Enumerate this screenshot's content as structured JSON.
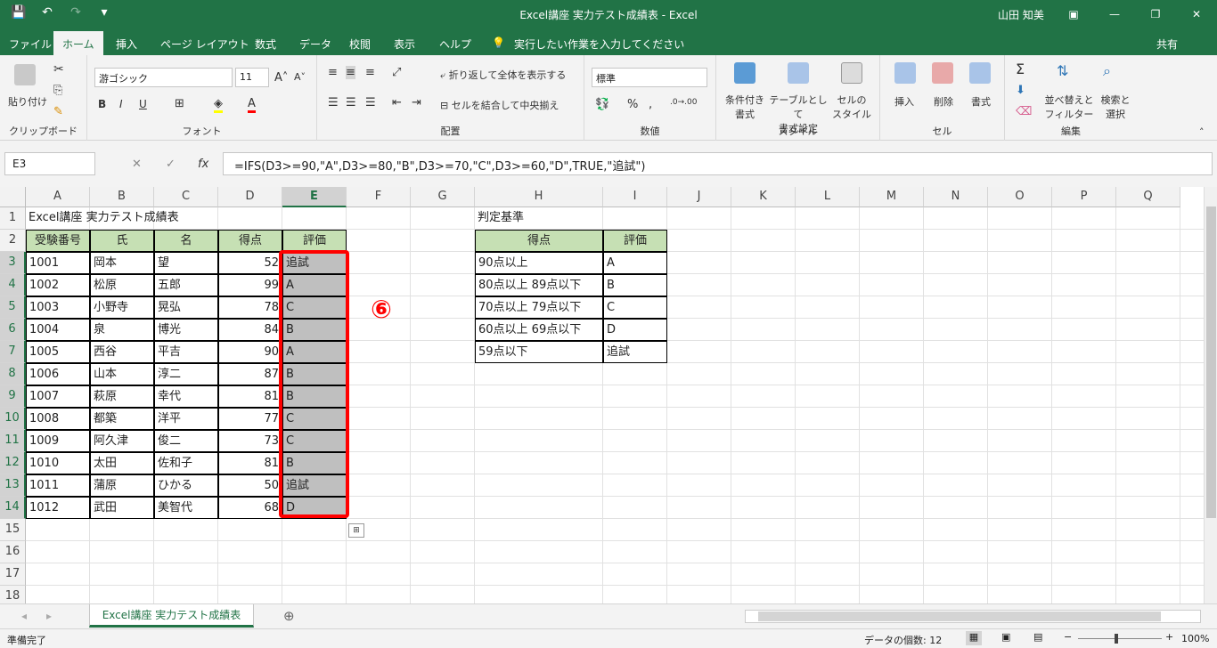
{
  "window": {
    "title": "Excel講座 実力テスト成績表  -  Excel",
    "user": "山田 知美"
  },
  "qat": {
    "save": "💾",
    "undo": "↶",
    "redo": "↷",
    "more": "▾"
  },
  "winbtns": {
    "ribbon_opts": "▣",
    "minimize": "—",
    "restore": "❐",
    "close": "✕"
  },
  "menu": {
    "tabs": [
      "ファイル",
      "ホーム",
      "挿入",
      "ページ レイアウト",
      "数式",
      "データ",
      "校閲",
      "表示",
      "ヘルプ"
    ],
    "tell_icon": "💡",
    "tell_me": "実行したい作業を入力してください",
    "share": "共有"
  },
  "ribbon": {
    "clipboard": {
      "paste": "貼り付け",
      "label": "クリップボード"
    },
    "font": {
      "family": "游ゴシック",
      "size": "11",
      "bold": "B",
      "italic": "I",
      "underline": "U",
      "label": "フォント"
    },
    "align": {
      "wrap": "折り返して全体を表示する",
      "merge": "セルを結合して中央揃え",
      "label": "配置"
    },
    "number": {
      "format": "標準",
      "percent": "%",
      "comma": ",",
      "label": "数値"
    },
    "styles": {
      "cond": "条件付き\n書式",
      "table": "テーブルとして\n書式設定",
      "cell": "セルの\nスタイル",
      "label": "スタイル"
    },
    "cells": {
      "insert": "挿入",
      "delete": "削除",
      "format": "書式",
      "label": "セル"
    },
    "edit": {
      "sort": "並べ替えと\nフィルター",
      "find": "検索と\n選択",
      "label": "編集"
    }
  },
  "formula_bar": {
    "namebox": "E3",
    "fx": "fx",
    "formula": "=IFS(D3>=90,\"A\",D3>=80,\"B\",D3>=70,\"C\",D3>=60,\"D\",TRUE,\"追試\")"
  },
  "columns": [
    "A",
    "B",
    "C",
    "D",
    "E",
    "F",
    "G",
    "H",
    "I",
    "J",
    "K",
    "L",
    "M",
    "N",
    "O",
    "P",
    "Q"
  ],
  "rows": [
    "1",
    "2",
    "3",
    "4",
    "5",
    "6",
    "7",
    "8",
    "9",
    "10",
    "11",
    "12",
    "13",
    "14",
    "15",
    "16",
    "17",
    "18"
  ],
  "sheet": {
    "title": "Excel講座 実力テスト成績表",
    "headers": [
      "受験番号",
      "氏",
      "名",
      "得点",
      "評価"
    ],
    "data": [
      [
        "1001",
        "岡本",
        "望",
        "52",
        "追試"
      ],
      [
        "1002",
        "松原",
        "五郎",
        "99",
        "A"
      ],
      [
        "1003",
        "小野寺",
        "晃弘",
        "78",
        "C"
      ],
      [
        "1004",
        "泉",
        "博光",
        "84",
        "B"
      ],
      [
        "1005",
        "西谷",
        "平吉",
        "90",
        "A"
      ],
      [
        "1006",
        "山本",
        "淳二",
        "87",
        "B"
      ],
      [
        "1007",
        "萩原",
        "幸代",
        "81",
        "B"
      ],
      [
        "1008",
        "都築",
        "洋平",
        "77",
        "C"
      ],
      [
        "1009",
        "阿久津",
        "俊二",
        "73",
        "C"
      ],
      [
        "1010",
        "太田",
        "佐和子",
        "81",
        "B"
      ],
      [
        "1011",
        "蒲原",
        "ひかる",
        "50",
        "追試"
      ],
      [
        "1012",
        "武田",
        "美智代",
        "68",
        "D"
      ]
    ],
    "criteria_title": "判定基準",
    "criteria_headers": [
      "得点",
      "評価"
    ],
    "criteria": [
      [
        "90点以上",
        "A"
      ],
      [
        "80点以上 89点以下",
        "B"
      ],
      [
        "70点以上 79点以下",
        "C"
      ],
      [
        "60点以上 69点以下",
        "D"
      ],
      [
        "59点以下",
        "追試"
      ]
    ]
  },
  "annotation": {
    "marker": "⑥"
  },
  "sheet_tabs": {
    "active": "Excel講座 実力テスト成績表",
    "add": "⊕"
  },
  "status": {
    "ready": "準備完了",
    "count_label": "データの個数: 12",
    "zoom": "100%"
  }
}
